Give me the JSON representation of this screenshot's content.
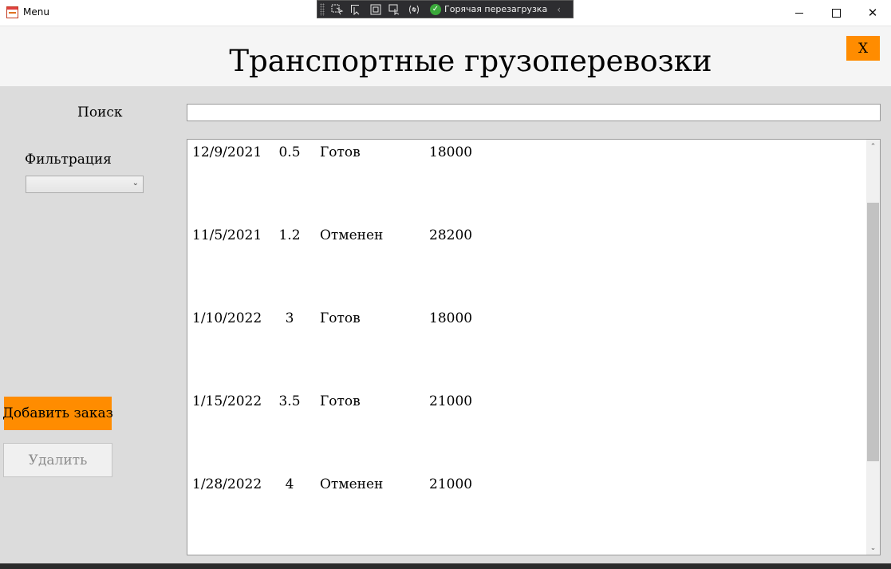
{
  "window": {
    "title": "Menu",
    "minimize_icon": "minimize-icon",
    "maximize_icon": "maximize-icon",
    "close_glyph": "✕"
  },
  "debug_toolbar": {
    "hot_reload_label": "Горячая перезагрузка",
    "check_glyph": "✓",
    "collapse_glyph": "‹"
  },
  "header": {
    "title": "Транспортные грузоперевозки",
    "close_label": "X"
  },
  "search": {
    "label": "Поиск",
    "value": "",
    "placeholder": ""
  },
  "filter": {
    "label": "Фильтрация",
    "selected": "",
    "chevron_glyph": "⌄"
  },
  "actions": {
    "add_label": "Добавить заказ",
    "delete_label": "Удалить"
  },
  "orders": [
    {
      "date": "12/9/2021",
      "weight": "0.5",
      "status": "Готов",
      "price": "18000"
    },
    {
      "date": "11/5/2021",
      "weight": "1.2",
      "status": "Отменен",
      "price": "28200"
    },
    {
      "date": "1/10/2022",
      "weight": "3",
      "status": "Готов",
      "price": "18000"
    },
    {
      "date": "1/15/2022",
      "weight": "3.5",
      "status": "Готов",
      "price": "21000"
    },
    {
      "date": "1/28/2022",
      "weight": "4",
      "status": "Отменен",
      "price": "21000"
    }
  ],
  "scroll": {
    "up_glyph": "⌃",
    "down_glyph": "⌄",
    "position_fraction": 0.19
  },
  "colors": {
    "accent": "#ff8c00",
    "background": "#dcdcdc",
    "header_background": "#f5f5f5"
  }
}
